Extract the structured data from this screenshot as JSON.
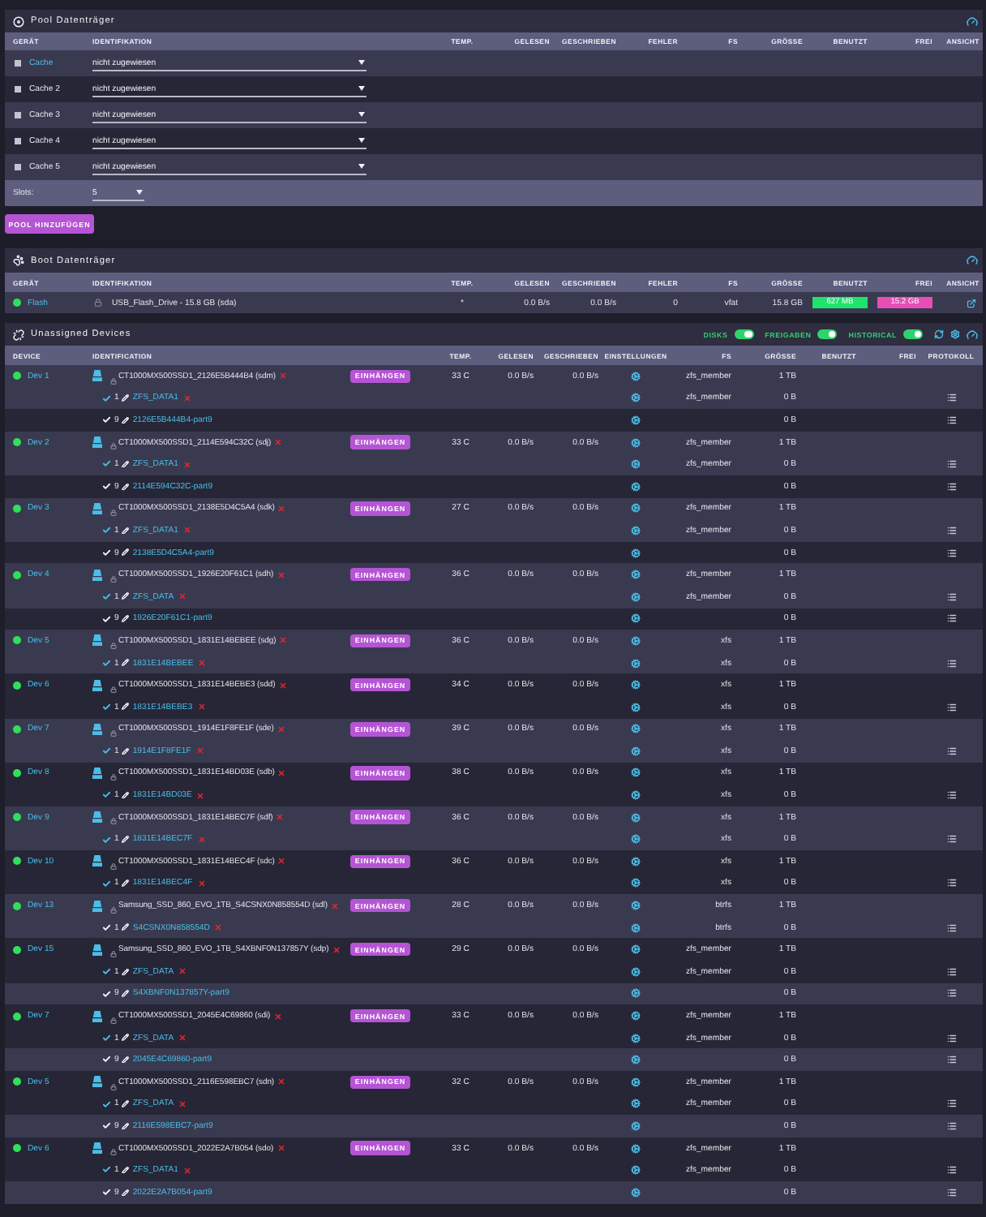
{
  "pool": {
    "title": "Pool Datenträger",
    "columns": [
      "GERÄT",
      "IDENTIFIKATION",
      "TEMP.",
      "GELESEN",
      "GESCHRIEBEN",
      "FEHLER",
      "FS",
      "GRÖSSE",
      "BENUTZT",
      "FREI",
      "ANSICHT"
    ],
    "devices": [
      {
        "name": "Cache",
        "link": true,
        "assignment": "nicht zugewiesen"
      },
      {
        "name": "Cache 2",
        "link": false,
        "assignment": "nicht zugewiesen"
      },
      {
        "name": "Cache 3",
        "link": false,
        "assignment": "nicht zugewiesen"
      },
      {
        "name": "Cache 4",
        "link": false,
        "assignment": "nicht zugewiesen"
      },
      {
        "name": "Cache 5",
        "link": false,
        "assignment": "nicht zugewiesen"
      }
    ],
    "slots": {
      "label": "Slots:",
      "value": "5"
    },
    "add_button": "POOL HINZUFÜGEN"
  },
  "boot": {
    "title": "Boot Datenträger",
    "columns": [
      "GERÄT",
      "IDENTIFIKATION",
      "TEMP.",
      "GELESEN",
      "GESCHRIEBEN",
      "FEHLER",
      "FS",
      "GRÖSSE",
      "BENUTZT",
      "FREI",
      "ANSICHT"
    ],
    "device": {
      "name": "Flash",
      "identification": "USB_Flash_Drive - 15.8 GB (sda)",
      "temp": "*",
      "read": "0.0 B/s",
      "written": "0.0 B/s",
      "errors": "0",
      "fs": "vfat",
      "size": "15.8 GB",
      "used": "627 MB",
      "free": "15.2 GB"
    }
  },
  "unassigned": {
    "title": "Unassigned Devices",
    "toggles": [
      {
        "label": "DISKS",
        "on": true
      },
      {
        "label": "FREIGABEN",
        "on": true
      },
      {
        "label": "HISTORICAL",
        "on": true
      }
    ],
    "columns": [
      "DEVICE",
      "IDENTIFICATION",
      "TEMP.",
      "GELESEN",
      "GESCHRIEBEN",
      "EINSTELLUNGEN",
      "FS",
      "GRÖSSE",
      "BENUTZT",
      "FREI",
      "PROTOKOLL"
    ],
    "devices": [
      {
        "name": "Dev 1",
        "identification": "CT1000MX500SSD1_2126E5B444B4 (sdm)",
        "button": "EINHÄNGEN",
        "temp": "33 C",
        "read": "0.0 B/s",
        "written": "0.0 B/s",
        "fs": "zfs_member",
        "size": "1 TB",
        "partitions": [
          {
            "number": "1",
            "check_on": true,
            "label": "ZFS_DATA1",
            "removable": true,
            "fs": "zfs_member",
            "size": "0 B"
          },
          {
            "number": "9",
            "check_on": false,
            "label": "2126E5B444B4-part9",
            "removable": false,
            "size": "0 B"
          }
        ]
      },
      {
        "name": "Dev 2",
        "identification": "CT1000MX500SSD1_2114E594C32C (sdj)",
        "button": "EINHÄNGEN",
        "temp": "33 C",
        "read": "0.0 B/s",
        "written": "0.0 B/s",
        "fs": "zfs_member",
        "size": "1 TB",
        "partitions": [
          {
            "number": "1",
            "check_on": true,
            "label": "ZFS_DATA1",
            "removable": true,
            "fs": "zfs_member",
            "size": "0 B"
          },
          {
            "number": "9",
            "check_on": false,
            "label": "2114E594C32C-part9",
            "removable": false,
            "size": "0 B"
          }
        ]
      },
      {
        "name": "Dev 3",
        "identification": "CT1000MX500SSD1_2138E5D4C5A4 (sdk)",
        "button": "EINHÄNGEN",
        "temp": "27 C",
        "read": "0.0 B/s",
        "written": "0.0 B/s",
        "fs": "zfs_member",
        "size": "1 TB",
        "partitions": [
          {
            "number": "1",
            "check_on": true,
            "label": "ZFS_DATA1",
            "removable": true,
            "fs": "zfs_member",
            "size": "0 B"
          },
          {
            "number": "9",
            "check_on": false,
            "label": "2138E5D4C5A4-part9",
            "removable": false,
            "size": "0 B"
          }
        ]
      },
      {
        "name": "Dev 4",
        "identification": "CT1000MX500SSD1_1926E20F61C1 (sdh)",
        "button": "EINHÄNGEN",
        "temp": "36 C",
        "read": "0.0 B/s",
        "written": "0.0 B/s",
        "fs": "zfs_member",
        "size": "1 TB",
        "partitions": [
          {
            "number": "1",
            "check_on": true,
            "label": "ZFS_DATA",
            "removable": true,
            "fs": "zfs_member",
            "size": "0 B"
          },
          {
            "number": "9",
            "check_on": false,
            "label": "1926E20F61C1-part9",
            "removable": false,
            "size": "0 B"
          }
        ]
      },
      {
        "name": "Dev 5",
        "identification": "CT1000MX500SSD1_1831E14BEBEE (sdg)",
        "button": "EINHÄNGEN",
        "temp": "36 C",
        "read": "0.0 B/s",
        "written": "0.0 B/s",
        "fs": "xfs",
        "size": "1 TB",
        "partitions": [
          {
            "number": "1",
            "check_on": true,
            "label": "1831E14BEBEE",
            "removable": true,
            "fs": "xfs",
            "size": "0 B"
          }
        ]
      },
      {
        "name": "Dev 6",
        "identification": "CT1000MX500SSD1_1831E14BEBE3 (sdd)",
        "button": "EINHÄNGEN",
        "temp": "34 C",
        "read": "0.0 B/s",
        "written": "0.0 B/s",
        "fs": "xfs",
        "size": "1 TB",
        "partitions": [
          {
            "number": "1",
            "check_on": true,
            "label": "1831E14BEBE3",
            "removable": true,
            "fs": "xfs",
            "size": "0 B"
          }
        ]
      },
      {
        "name": "Dev 7",
        "identification": "CT1000MX500SSD1_1914E1F8FE1F (sde)",
        "button": "EINHÄNGEN",
        "temp": "39 C",
        "read": "0.0 B/s",
        "written": "0.0 B/s",
        "fs": "xfs",
        "size": "1 TB",
        "partitions": [
          {
            "number": "1",
            "check_on": true,
            "label": "1914E1F8FE1F",
            "removable": true,
            "fs": "xfs",
            "size": "0 B"
          }
        ]
      },
      {
        "name": "Dev 8",
        "identification": "CT1000MX500SSD1_1831E14BD03E (sdb)",
        "button": "EINHÄNGEN",
        "temp": "38 C",
        "read": "0.0 B/s",
        "written": "0.0 B/s",
        "fs": "xfs",
        "size": "1 TB",
        "partitions": [
          {
            "number": "1",
            "check_on": true,
            "label": "1831E14BD03E",
            "removable": true,
            "fs": "xfs",
            "size": "0 B"
          }
        ]
      },
      {
        "name": "Dev 9",
        "identification": "CT1000MX500SSD1_1831E14BEC7F (sdf)",
        "button": "EINHÄNGEN",
        "temp": "36 C",
        "read": "0.0 B/s",
        "written": "0.0 B/s",
        "fs": "xfs",
        "size": "1 TB",
        "partitions": [
          {
            "number": "1",
            "check_on": true,
            "label": "1831E14BEC7F",
            "removable": true,
            "fs": "xfs",
            "size": "0 B"
          }
        ]
      },
      {
        "name": "Dev 10",
        "identification": "CT1000MX500SSD1_1831E14BEC4F (sdc)",
        "button": "EINHÄNGEN",
        "temp": "36 C",
        "read": "0.0 B/s",
        "written": "0.0 B/s",
        "fs": "xfs",
        "size": "1 TB",
        "partitions": [
          {
            "number": "1",
            "check_on": true,
            "label": "1831E14BEC4F",
            "removable": true,
            "fs": "xfs",
            "size": "0 B"
          }
        ]
      },
      {
        "name": "Dev 13",
        "identification": "Samsung_SSD_860_EVO_1TB_S4CSNX0N858554D (sdl)",
        "button": "EINHÄNGEN",
        "temp": "28 C",
        "read": "0.0 B/s",
        "written": "0.0 B/s",
        "fs": "btrfs",
        "size": "1 TB",
        "partitions": [
          {
            "number": "1",
            "check_on": false,
            "label": "S4CSNX0N858554D",
            "removable": true,
            "fs": "btrfs",
            "size": "0 B"
          }
        ]
      },
      {
        "name": "Dev 15",
        "identification": "Samsung_SSD_860_EVO_1TB_S4XBNF0N137857Y (sdp)",
        "button": "EINHÄNGEN",
        "temp": "29 C",
        "read": "0.0 B/s",
        "written": "0.0 B/s",
        "fs": "zfs_member",
        "size": "1 TB",
        "partitions": [
          {
            "number": "1",
            "check_on": true,
            "label": "ZFS_DATA",
            "removable": true,
            "fs": "zfs_member",
            "size": "0 B"
          },
          {
            "number": "9",
            "check_on": false,
            "label": "S4XBNF0N137857Y-part9",
            "removable": false,
            "size": "0 B"
          }
        ]
      },
      {
        "name": "Dev 7",
        "identification": "CT1000MX500SSD1_2045E4C69860 (sdi)",
        "button": "EINHÄNGEN",
        "temp": "33 C",
        "read": "0.0 B/s",
        "written": "0.0 B/s",
        "fs": "zfs_member",
        "size": "1 TB",
        "partitions": [
          {
            "number": "1",
            "check_on": true,
            "label": "ZFS_DATA",
            "removable": true,
            "fs": "zfs_member",
            "size": "0 B"
          },
          {
            "number": "9",
            "check_on": false,
            "label": "2045E4C69860-part9",
            "removable": false,
            "size": "0 B"
          }
        ]
      },
      {
        "name": "Dev 5",
        "identification": "CT1000MX500SSD1_2116E598EBC7 (sdn)",
        "button": "EINHÄNGEN",
        "temp": "32 C",
        "read": "0.0 B/s",
        "written": "0.0 B/s",
        "fs": "zfs_member",
        "size": "1 TB",
        "partitions": [
          {
            "number": "1",
            "check_on": true,
            "label": "ZFS_DATA",
            "removable": true,
            "fs": "zfs_member",
            "size": "0 B"
          },
          {
            "number": "9",
            "check_on": false,
            "label": "2116E598EBC7-part9",
            "removable": false,
            "size": "0 B"
          }
        ]
      },
      {
        "name": "Dev 6",
        "identification": "CT1000MX500SSD1_2022E2A7B054 (sdo)",
        "button": "EINHÄNGEN",
        "temp": "33 C",
        "read": "0.0 B/s",
        "written": "0.0 B/s",
        "fs": "zfs_member",
        "size": "1 TB",
        "partitions": [
          {
            "number": "1",
            "check_on": true,
            "label": "ZFS_DATA1",
            "removable": true,
            "fs": "zfs_member",
            "size": "0 B"
          },
          {
            "number": "9",
            "check_on": false,
            "label": "2022E2A7B054-part9",
            "removable": false,
            "size": "0 B"
          }
        ]
      }
    ]
  }
}
